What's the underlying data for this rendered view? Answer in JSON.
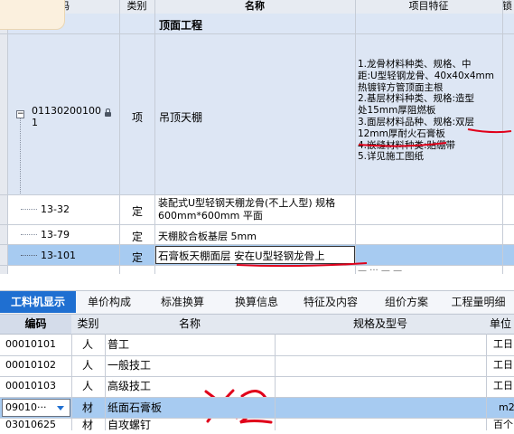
{
  "top_table": {
    "headers": {
      "code": "码",
      "type": "类别",
      "name": "名称",
      "feature": "项目特征",
      "lock": "锁"
    },
    "section_title": "顶面工程",
    "main_row": {
      "code": "01130200100\n1",
      "type": "项",
      "name": "吊顶天棚",
      "features": [
        "1.龙骨材料种类、规格、中",
        "距:U型轻钢龙骨、40x40x4mm",
        "热镀锌方管顶面主根",
        "2.基层材料种类、规格:造型",
        "处15mm厚阻燃板",
        "3.面层材料品种、规格:双层",
        "12mm厚耐火石膏板",
        "4.嵌缝材料种类:贴绷带",
        "5.详见施工图纸"
      ]
    },
    "sub_rows": [
      {
        "code": "13-32",
        "type": "定",
        "name": "装配式U型轻钢天棚龙骨(不上人型) 规格\n600mm*600mm 平面"
      },
      {
        "code": "13-79",
        "type": "定",
        "name": "天棚胶合板基层 5mm"
      },
      {
        "code": "13-101",
        "type": "定",
        "name": "石膏板天棚面层 安在U型轻钢龙骨上"
      }
    ]
  },
  "tabs": [
    "工料机显示",
    "单价构成",
    "标准换算",
    "换算信息",
    "特征及内容",
    "组价方案",
    "工程量明细"
  ],
  "bottom_table": {
    "headers": {
      "code": "编码",
      "type": "类别",
      "name": "名称",
      "spec": "规格及型号",
      "unit": "单位"
    },
    "rows": [
      {
        "code": "00010101",
        "type": "人",
        "name": "普工",
        "unit": "工日"
      },
      {
        "code": "00010102",
        "type": "人",
        "name": "一般技工",
        "unit": "工日"
      },
      {
        "code": "00010103",
        "type": "人",
        "name": "高级技工",
        "unit": "工日"
      },
      {
        "code": "09010···",
        "type": "材",
        "name": "纸面石膏板",
        "unit": "m2"
      },
      {
        "code": "03010625",
        "type": "材",
        "name": "自攻螺钉",
        "unit": "百个"
      }
    ]
  },
  "colors": {
    "selected_row": "#a7cbf1",
    "header_bg": "#e3e8f0",
    "active_tab": "#1f6fd1",
    "red_ink": "#e0001a"
  },
  "annotation": {
    "text": "X2"
  }
}
